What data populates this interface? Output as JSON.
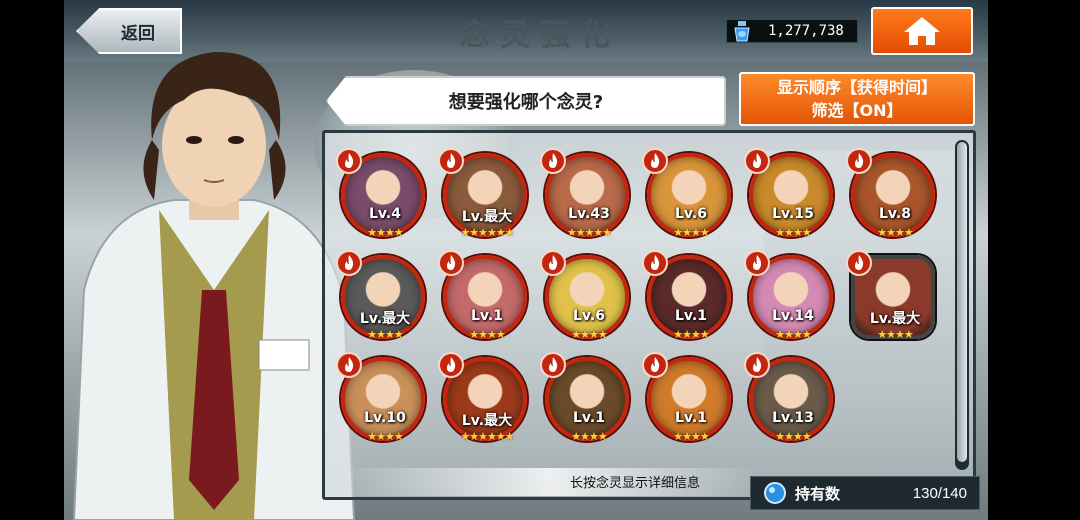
{
  "header": {
    "back_label": "返回",
    "title": "念灵强化",
    "currency_value": "1,277,738",
    "currency_icon": "crystal-bottle-icon",
    "home_icon": "home-icon"
  },
  "prompt": {
    "question": "想要强化哪个念灵?"
  },
  "sort": {
    "line1": "显示顺序【获得时间】",
    "line2": "筛选【ON】"
  },
  "units": [
    {
      "level": "Lv.4",
      "stars": "★★★★",
      "color": "#7a4b6a",
      "shape": "round"
    },
    {
      "level": "Lv.最大",
      "stars": "★★★★★★",
      "color": "#8a5a3c",
      "shape": "round"
    },
    {
      "level": "Lv.43",
      "stars": "★★★★★",
      "color": "#b86a4a",
      "shape": "round"
    },
    {
      "level": "Lv.6",
      "stars": "★★★★",
      "color": "#d9953a",
      "shape": "round"
    },
    {
      "level": "Lv.15",
      "stars": "★★★★",
      "color": "#c98a2a",
      "shape": "round"
    },
    {
      "level": "Lv.8",
      "stars": "★★★★",
      "color": "#a8562a",
      "shape": "round"
    },
    {
      "level": "Lv.最大",
      "stars": "★★★★",
      "color": "#5a5a5a",
      "shape": "round"
    },
    {
      "level": "Lv.1",
      "stars": "★★★★",
      "color": "#c46a6a",
      "shape": "round"
    },
    {
      "level": "Lv.6",
      "stars": "★★★★",
      "color": "#e0c24a",
      "shape": "round"
    },
    {
      "level": "Lv.1",
      "stars": "★★★★",
      "color": "#5a2a2a",
      "shape": "round"
    },
    {
      "level": "Lv.14",
      "stars": "★★★★",
      "color": "#d48ab4",
      "shape": "round"
    },
    {
      "level": "Lv.最大",
      "stars": "★★★★",
      "color": "#8a3a2a",
      "shape": "hex"
    },
    {
      "level": "Lv.10",
      "stars": "★★★★",
      "color": "#c9905a",
      "shape": "round"
    },
    {
      "level": "Lv.最大",
      "stars": "★★★★★★",
      "color": "#9a3a1a",
      "shape": "round"
    },
    {
      "level": "Lv.1",
      "stars": "★★★★",
      "color": "#6a4a2a",
      "shape": "round"
    },
    {
      "level": "Lv.1",
      "stars": "★★★★",
      "color": "#d07a2a",
      "shape": "round"
    },
    {
      "level": "Lv.13",
      "stars": "★★★★",
      "color": "#6a5a4a",
      "shape": "round"
    }
  ],
  "footer": {
    "hint": "长按念灵显示详细信息",
    "holdings_label": "持有数",
    "holdings_count": "130/140"
  }
}
